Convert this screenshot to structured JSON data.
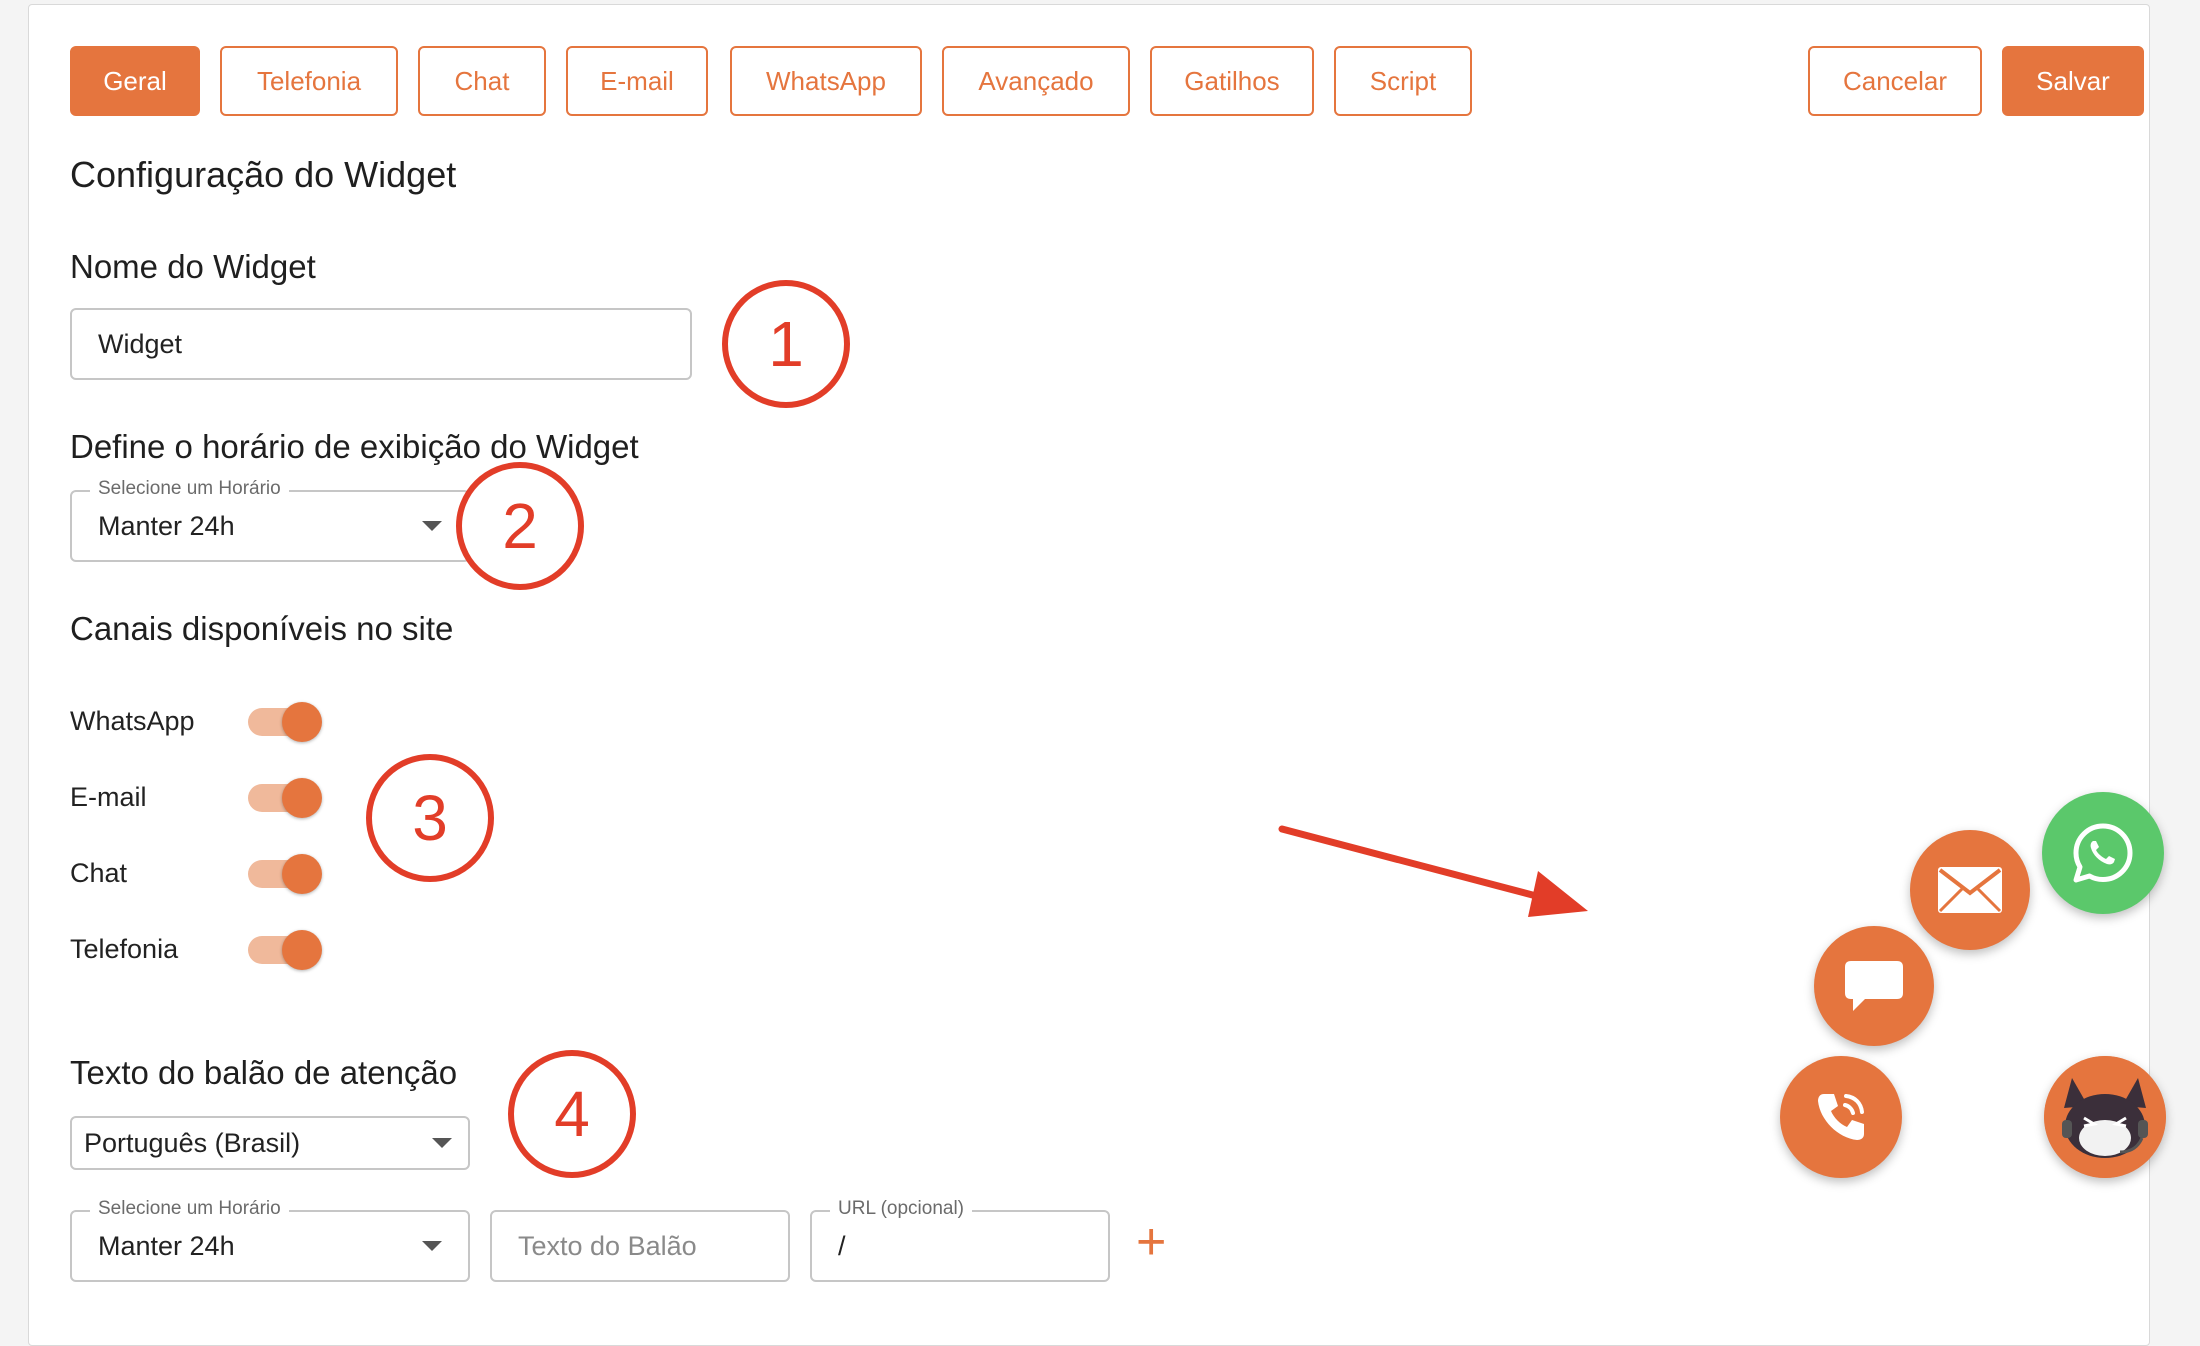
{
  "tabs": [
    {
      "label": "Geral",
      "active": true
    },
    {
      "label": "Telefonia",
      "active": false
    },
    {
      "label": "Chat",
      "active": false
    },
    {
      "label": "E-mail",
      "active": false
    },
    {
      "label": "WhatsApp",
      "active": false
    },
    {
      "label": "Avançado",
      "active": false
    },
    {
      "label": "Gatilhos",
      "active": false
    },
    {
      "label": "Script",
      "active": false
    }
  ],
  "actions": {
    "cancel_label": "Cancelar",
    "save_label": "Salvar"
  },
  "page_title": "Configuração do Widget",
  "widget_name": {
    "label": "Nome do Widget",
    "value": "Widget"
  },
  "schedule": {
    "label": "Define o horário de exibição do Widget",
    "select_legend": "Selecione um Horário",
    "select_value": "Manter 24h"
  },
  "channels": {
    "label": "Canais disponíveis no site",
    "items": [
      {
        "label": "WhatsApp",
        "enabled": true
      },
      {
        "label": "E-mail",
        "enabled": true
      },
      {
        "label": "Chat",
        "enabled": true
      },
      {
        "label": "Telefonia",
        "enabled": true
      }
    ]
  },
  "balloon": {
    "label": "Texto do balão de atenção",
    "language_value": "Português (Brasil)",
    "schedule_legend": "Selecione um Horário",
    "schedule_value": "Manter 24h",
    "text_placeholder": "Texto do Balão",
    "url_legend": "URL (opcional)",
    "url_value": "/",
    "add_symbol": "+"
  },
  "markers": [
    "1",
    "2",
    "3",
    "4"
  ],
  "colors": {
    "accent": "#e5753e",
    "accent_light": "#f0b99b",
    "marker_red": "#e23d28",
    "whatsapp_green": "#5bc86b"
  },
  "icons": {
    "whatsapp": "whatsapp-icon",
    "email": "envelope-icon",
    "chat": "chat-bubble-icon",
    "phone": "phone-icon",
    "avatar": "fox-mascot-icon"
  }
}
